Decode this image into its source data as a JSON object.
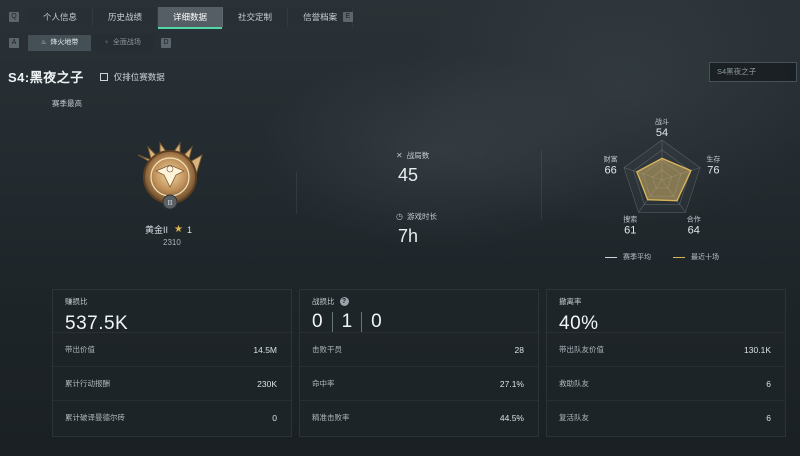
{
  "nav": {
    "left_key": "Q",
    "right_key": "E",
    "tabs": [
      {
        "label": "个人信息"
      },
      {
        "label": "历史战绩"
      },
      {
        "label": "详细数据"
      },
      {
        "label": "社交定制"
      },
      {
        "label": "信誉档案"
      }
    ],
    "active_tab": 2
  },
  "subnav": {
    "left_key": "A",
    "right_key": "D",
    "tabs": [
      {
        "label": "烽火地带",
        "icon": "beacon-icon"
      },
      {
        "label": "全面战场",
        "icon": "battlefield-icon"
      }
    ],
    "active_tab": 0
  },
  "season": {
    "title": "S4:黑夜之子",
    "filter_label": "仅排位赛数据",
    "filter_checked": false,
    "dropdown_value": "S4黑夜之子"
  },
  "best": {
    "label": "赛季最高",
    "rank_name": "黄金II",
    "stars": "1",
    "score": "2310"
  },
  "mid_stats": {
    "battles_label": "战局数",
    "battles_value": "45",
    "playtime_label": "游戏时长",
    "playtime_value": "7h"
  },
  "radar": {
    "axes": [
      {
        "name": "战斗",
        "value": "54"
      },
      {
        "name": "生存",
        "value": "76"
      },
      {
        "name": "合作",
        "value": "64"
      },
      {
        "name": "搜索",
        "value": "61"
      },
      {
        "name": "财富",
        "value": "66"
      }
    ],
    "legend_season": "赛季平均",
    "legend_recent": "最近十场",
    "color_season": "#cfd6da",
    "color_recent": "#d9b35a"
  },
  "chart_data": {
    "type": "radar",
    "categories": [
      "战斗",
      "生存",
      "合作",
      "搜索",
      "财富"
    ],
    "series": [
      {
        "name": "赛季平均",
        "values": [
          54,
          76,
          64,
          61,
          66
        ]
      },
      {
        "name": "最近十场",
        "values": [
          54,
          76,
          64,
          61,
          66
        ]
      }
    ],
    "ylim": [
      0,
      100
    ]
  },
  "cards": {
    "earn": {
      "label": "赚损比",
      "value": "537.5K",
      "rows": [
        {
          "label": "带出价值",
          "value": "14.5M"
        },
        {
          "label": "累计行动报酬",
          "value": "230K"
        },
        {
          "label": "累计破译曼德尔砖",
          "value": "0"
        }
      ]
    },
    "kd": {
      "label": "战损比",
      "help": "?",
      "values": [
        "0",
        "1",
        "0"
      ],
      "rows": [
        {
          "label": "击败干员",
          "value": "28"
        },
        {
          "label": "命中率",
          "value": "27.1%"
        },
        {
          "label": "精准击败率",
          "value": "44.5%"
        }
      ]
    },
    "extract": {
      "label": "撤离率",
      "value": "40%",
      "rows": [
        {
          "label": "带出队友价值",
          "value": "130.1K"
        },
        {
          "label": "救助队友",
          "value": "6"
        },
        {
          "label": "复活队友",
          "value": "6"
        }
      ]
    }
  }
}
